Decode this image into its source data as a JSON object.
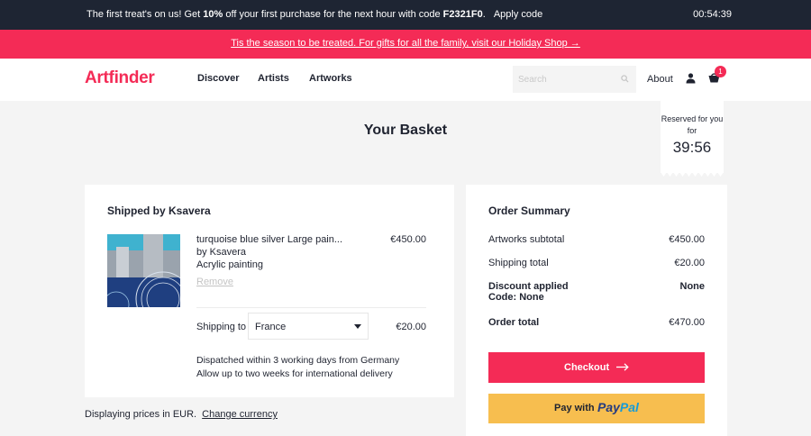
{
  "promo_bar": {
    "text_before": "The first treat's on us! Get ",
    "discount": "10%",
    "text_middle": " off your first purchase for the next hour with code ",
    "code": "F2321F0",
    "text_end": ".",
    "apply_label": "Apply code",
    "timer": "00:54:39"
  },
  "holiday_bar": {
    "link_text": "Tis the season to be treated. For gifts for all the family, visit our Holiday Shop →"
  },
  "header": {
    "logo": "Artfinder",
    "nav": [
      "Discover",
      "Artists",
      "Artworks"
    ],
    "search_placeholder": "Search",
    "about": "About",
    "cart_count": "1",
    "icons": [
      "search-icon",
      "user-icon",
      "cart-icon"
    ]
  },
  "page": {
    "title": "Your Basket"
  },
  "reserved": {
    "label": "Reserved for you for",
    "time": "39:56"
  },
  "basket": {
    "shipped_by": "Shipped by Ksavera",
    "item": {
      "title": "turquoise blue silver Large pain...",
      "artist": "by Ksavera",
      "medium": "Acrylic painting",
      "remove": "Remove",
      "price": "€450.00"
    },
    "shipping": {
      "label": "Shipping to",
      "country": "France",
      "price": "€20.00"
    },
    "dispatch_line1": "Dispatched within 3 working days from Germany",
    "dispatch_line2": "Allow up to two weeks for international delivery"
  },
  "summary": {
    "title": "Order Summary",
    "subtotal_label": "Artworks subtotal",
    "subtotal": "€450.00",
    "shipping_label": "Shipping total",
    "shipping": "€20.00",
    "discount_label": "Discount applied",
    "discount_code_label": "Code: None",
    "discount": "None",
    "total_label": "Order total",
    "total": "€470.00",
    "checkout_label": "Checkout",
    "paypal_label": "Pay with",
    "paypal_logo_pay": "Pay",
    "paypal_logo_pal": "Pal"
  },
  "footer": {
    "currency_text": "Displaying prices in EUR.",
    "change_currency": "Change currency"
  },
  "colors": {
    "brand": "#f42b56",
    "dark": "#1e2533",
    "paypal_yellow": "#f7be4f"
  }
}
